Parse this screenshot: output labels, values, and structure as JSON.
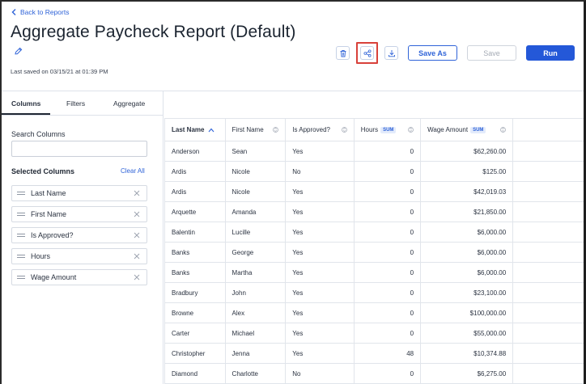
{
  "header": {
    "back_label": "Back to Reports",
    "title": "Aggregate Paycheck Report (Default)",
    "last_saved": "Last saved on 03/15/21 at 01:39 PM"
  },
  "toolbar": {
    "delete_icon": "trash-icon",
    "share_icon": "share-icon",
    "download_icon": "download-icon",
    "save_as_label": "Save As",
    "save_label": "Save",
    "run_label": "Run"
  },
  "sidebar": {
    "tabs": [
      {
        "label": "Columns",
        "active": true
      },
      {
        "label": "Filters",
        "active": false
      },
      {
        "label": "Aggregate",
        "active": false
      }
    ],
    "search_label": "Search Columns",
    "search_value": "",
    "selected_label": "Selected Columns",
    "clear_all_label": "Clear All",
    "selected_columns": [
      "Last Name",
      "First Name",
      "Is Approved?",
      "Hours",
      "Wage Amount"
    ]
  },
  "table": {
    "columns": [
      {
        "label": "Last Name",
        "sorted": "asc"
      },
      {
        "label": "First Name"
      },
      {
        "label": "Is Approved?"
      },
      {
        "label": "Hours",
        "badge": "SUM"
      },
      {
        "label": "Wage Amount",
        "badge": "SUM"
      }
    ],
    "rows": [
      [
        "Anderson",
        "Sean",
        "Yes",
        "0",
        "$62,260.00"
      ],
      [
        "Ardis",
        "Nicole",
        "No",
        "0",
        "$125.00"
      ],
      [
        "Ardis",
        "Nicole",
        "Yes",
        "0",
        "$42,019.03"
      ],
      [
        "Arquette",
        "Amanda",
        "Yes",
        "0",
        "$21,850.00"
      ],
      [
        "Balentin",
        "Lucille",
        "Yes",
        "0",
        "$6,000.00"
      ],
      [
        "Banks",
        "George",
        "Yes",
        "0",
        "$6,000.00"
      ],
      [
        "Banks",
        "Martha",
        "Yes",
        "0",
        "$6,000.00"
      ],
      [
        "Bradbury",
        "John",
        "Yes",
        "0",
        "$23,100.00"
      ],
      [
        "Browne",
        "Alex",
        "Yes",
        "0",
        "$100,000.00"
      ],
      [
        "Carter",
        "Michael",
        "Yes",
        "0",
        "$55,000.00"
      ],
      [
        "Christopher",
        "Jenna",
        "Yes",
        "48",
        "$10,374.88"
      ],
      [
        "Diamond",
        "Charlotte",
        "No",
        "0",
        "$6,275.00"
      ]
    ]
  },
  "colors": {
    "accent": "#2458d8",
    "link": "#2f63d8",
    "highlight_box": "#d8413a"
  }
}
